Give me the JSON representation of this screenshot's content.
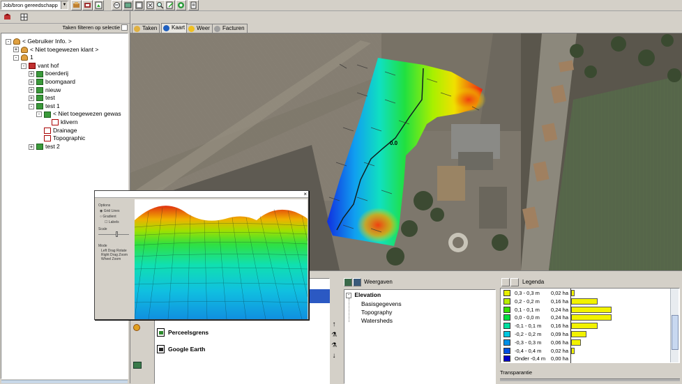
{
  "toolbar": {
    "job_dropdown": "Job/bron gereedschapp"
  },
  "left_panel": {
    "filter_label": "Taken filteren op selectie",
    "tree": [
      {
        "label": "< Gebruiker Info. >",
        "level": 0,
        "expander": "-",
        "icon": "user"
      },
      {
        "label": "< Niet toegewezen klant >",
        "level": 1,
        "expander": "+",
        "icon": "user"
      },
      {
        "label": "1",
        "level": 1,
        "expander": "-",
        "icon": "user"
      },
      {
        "label": "vant hof",
        "level": 2,
        "expander": "-",
        "icon": "farm"
      },
      {
        "label": "boerderij",
        "level": 3,
        "expander": "+",
        "icon": "field"
      },
      {
        "label": "boomgaard",
        "level": 3,
        "expander": "+",
        "icon": "field"
      },
      {
        "label": "nieuw",
        "level": 3,
        "expander": "+",
        "icon": "field"
      },
      {
        "label": "test",
        "level": 3,
        "expander": "+",
        "icon": "field"
      },
      {
        "label": "test 1",
        "level": 3,
        "expander": "-",
        "icon": "field"
      },
      {
        "label": "< Niet toegewezen gewas",
        "level": 4,
        "expander": "-",
        "icon": "crop"
      },
      {
        "label": "klivern",
        "level": 5,
        "expander": "",
        "icon": "check"
      },
      {
        "label": "Drainage",
        "level": 4,
        "expander": "",
        "icon": "doc"
      },
      {
        "label": "Topographic",
        "level": 4,
        "expander": "",
        "icon": "doc"
      },
      {
        "label": "test 2",
        "level": 3,
        "expander": "+",
        "icon": "field"
      }
    ]
  },
  "tabs": [
    {
      "label": "Taken",
      "active": false
    },
    {
      "label": "Kaart",
      "active": true
    },
    {
      "label": "Weer",
      "active": false
    },
    {
      "label": "Facturen",
      "active": false
    }
  ],
  "map": {
    "contour_label": "0.0"
  },
  "popup": {
    "options_label": "Options",
    "radio_1": "Grid Lines",
    "radio_2": "Gradient",
    "checkbox": "Labels",
    "scale_label": "Scale",
    "mode_label": "Mode",
    "mode_row_1": "Left  Drag  Rotate",
    "mode_row_2": "Right  Drag  Zoom",
    "mode_row_3": "Wheel  Zoom"
  },
  "layers": {
    "items": [
      {
        "label": "Perceelsgrens"
      },
      {
        "label": "Google Earth"
      }
    ]
  },
  "weergaven": {
    "header": "Weergaven",
    "root": "Elevation",
    "children": [
      "Basisgegevens",
      "Topography",
      "Watersheds"
    ]
  },
  "legend": {
    "header": "Legenda",
    "transparency_label": "Transparantie",
    "rows": [
      {
        "range": "0,3 - 0,3 m",
        "area": "0,02 ha",
        "color": "#e8f000",
        "bar": 4
      },
      {
        "range": "0,2 - 0,2 m",
        "area": "0,16 ha",
        "color": "#b8ee00",
        "bar": 32
      },
      {
        "range": "0,1 - 0,1 m",
        "area": "0,24 ha",
        "color": "#38e000",
        "bar": 48
      },
      {
        "range": "0,0 - 0,0 m",
        "area": "0,24 ha",
        "color": "#00e040",
        "bar": 48
      },
      {
        "range": "-0,1 - 0,1 m",
        "area": "0,16 ha",
        "color": "#00e0a0",
        "bar": 32
      },
      {
        "range": "-0,2 - 0,2 m",
        "area": "0,09 ha",
        "color": "#00c8e0",
        "bar": 18
      },
      {
        "range": "-0,3 - 0,3 m",
        "area": "0,06 ha",
        "color": "#0090e8",
        "bar": 12
      },
      {
        "range": "-0,4 - 0,4 m",
        "area": "0,02 ha",
        "color": "#0050e0",
        "bar": 4
      },
      {
        "range": "Onder -0,4 m",
        "area": "0,00 ha",
        "color": "#0000c8",
        "bar": 0
      }
    ]
  }
}
